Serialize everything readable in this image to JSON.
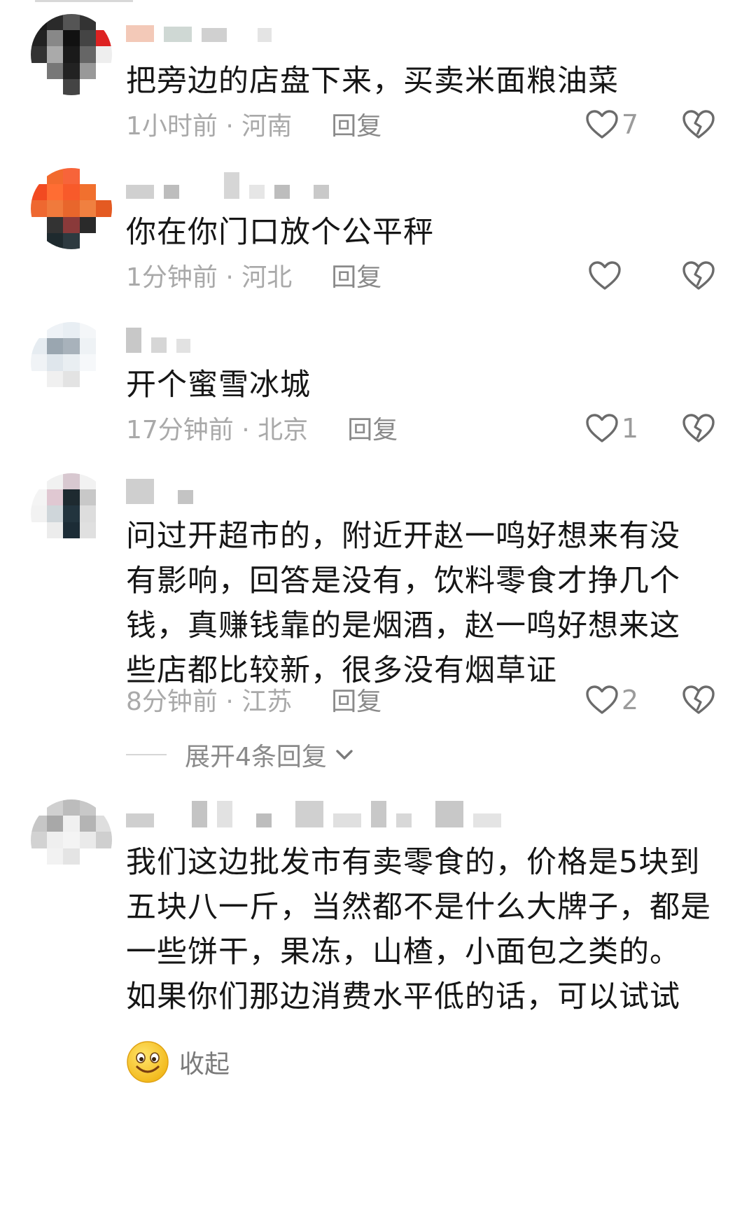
{
  "comments": [
    {
      "content": "把旁边的店盘下来，买卖米面粮油菜",
      "time": "1小时前",
      "location": "河南",
      "reply_label": "回复",
      "likes": "7"
    },
    {
      "content": "你在你门口放个公平秤",
      "time": "1分钟前",
      "location": "河北",
      "reply_label": "回复",
      "likes": ""
    },
    {
      "content": "开个蜜雪冰城",
      "time": "17分钟前",
      "location": "北京",
      "reply_label": "回复",
      "likes": "1"
    },
    {
      "content": "问过开超市的，附近开赵一鸣好想来有没有影响，回答是没有，饮料零食才挣几个钱，真赚钱靠的是烟酒，赵一鸣好想来这些店都比较新，很多没有烟草证",
      "time": "8分钟前",
      "location": "江苏",
      "reply_label": "回复",
      "likes": "2",
      "expand_label": "展开4条回复"
    },
    {
      "content": "我们这边批发市有卖零食的，价格是5块到五块八一斤，当然都不是什么大牌子，都是一些饼干，果冻，山楂，小面包之类的。\n如果你们那边消费水平低的话，可以试试",
      "collapse_label": "收起"
    }
  ],
  "separator": "·",
  "icons": {
    "like": "heart-outline-icon",
    "dislike": "broken-heart-icon",
    "expand": "chevron-down-icon",
    "emoji": "smiley-emoji-icon"
  },
  "colors": {
    "text": "#161616",
    "meta": "#a9a9a9",
    "reply": "#8a8a8a",
    "icon": "#6b6b6b"
  }
}
